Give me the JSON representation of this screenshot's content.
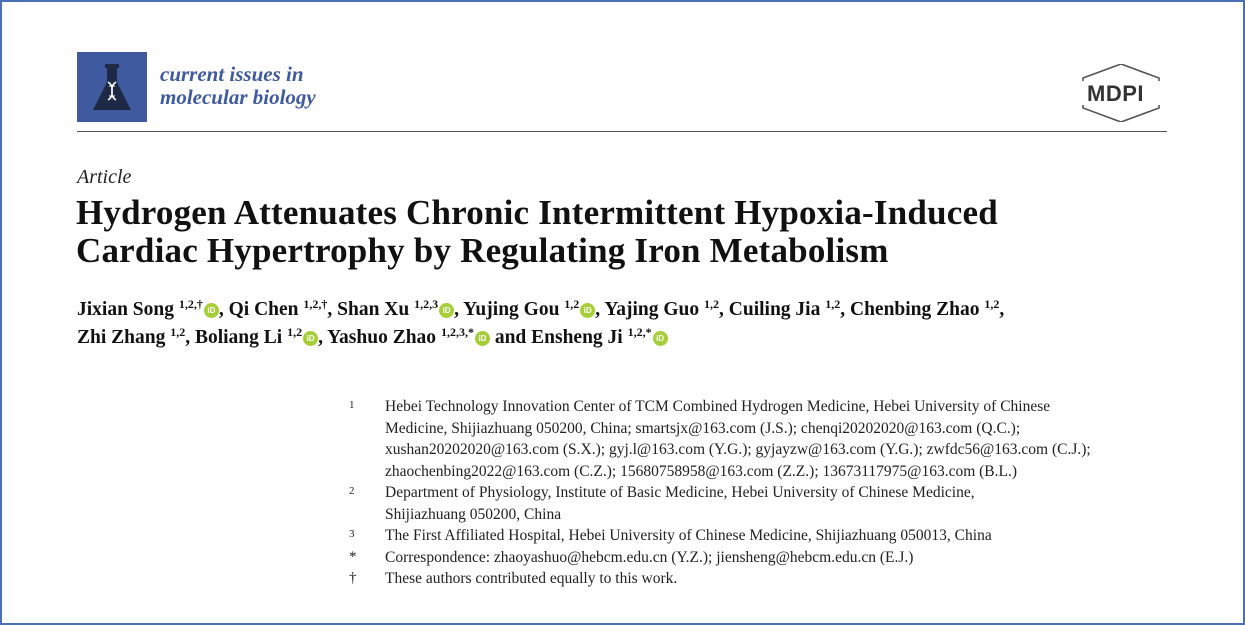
{
  "journal": {
    "name_lines": [
      "current issues in",
      "molecular biology"
    ],
    "logo_icon": "flask-dna-icon"
  },
  "publisher": {
    "logo_text": "MDPI"
  },
  "article": {
    "type": "Article",
    "title_lines": [
      "Hydrogen Attenuates Chronic Intermittent Hypoxia-Induced",
      "Cardiac Hypertrophy by Regulating Iron Metabolism"
    ]
  },
  "authors": [
    {
      "name": "Jixian Song",
      "sup": "1,2,†",
      "orcid": true,
      "sep": ","
    },
    {
      "name": "Qi Chen",
      "sup": "1,2,†",
      "orcid": false,
      "sep": ","
    },
    {
      "name": "Shan Xu",
      "sup": "1,2,3",
      "orcid": true,
      "sep": ","
    },
    {
      "name": "Yujing Gou",
      "sup": "1,2",
      "orcid": true,
      "sep": ","
    },
    {
      "name": "Yajing Guo",
      "sup": "1,2",
      "orcid": false,
      "sep": ","
    },
    {
      "name": "Cuiling Jia",
      "sup": "1,2",
      "orcid": false,
      "sep": ","
    },
    {
      "name": "Chenbing Zhao",
      "sup": "1,2",
      "orcid": false,
      "sep": ","
    },
    {
      "name": "Zhi Zhang",
      "sup": "1,2",
      "orcid": false,
      "sep": ","
    },
    {
      "name": "Boliang Li",
      "sup": "1,2",
      "orcid": true,
      "sep": ","
    },
    {
      "name": "Yashuo Zhao",
      "sup": "1,2,3,*",
      "orcid": true,
      "sep": " and"
    },
    {
      "name": "Ensheng Ji",
      "sup": "1,2,*",
      "orcid": true,
      "sep": ""
    }
  ],
  "orcid_label": "iD",
  "affiliations": [
    {
      "mark": "1",
      "lines": [
        "Hebei Technology Innovation Center of TCM Combined Hydrogen Medicine, Hebei University of Chinese",
        "Medicine, Shijiazhuang 050200, China; smartsjx@163.com (J.S.); chenqi20202020@163.com (Q.C.);",
        "xushan20202020@163.com (S.X.); gyj.l@163.com (Y.G.); gyjayzw@163.com (Y.G.); zwfdc56@163.com (C.J.);",
        "zhaochenbing2022@163.com (C.Z.); 15680758958@163.com (Z.Z.); 13673117975@163.com (B.L.)"
      ]
    },
    {
      "mark": "2",
      "lines": [
        "Department of Physiology, Institute of Basic Medicine, Hebei University of Chinese Medicine,",
        "Shijiazhuang 050200, China"
      ]
    },
    {
      "mark": "3",
      "lines": [
        "The First Affiliated Hospital, Hebei University of Chinese Medicine, Shijiazhuang 050013, China"
      ]
    },
    {
      "mark": "*",
      "lines": [
        "Correspondence: zhaoyashuo@hebcm.edu.cn (Y.Z.); jiensheng@hebcm.edu.cn (E.J.)"
      ]
    },
    {
      "mark": "†",
      "lines": [
        "These authors contributed equally to this work."
      ]
    }
  ],
  "colors": {
    "journal_blue": "#3f5a9e",
    "orcid_green": "#a6ce39",
    "frame_border": "#4a6fb5"
  }
}
